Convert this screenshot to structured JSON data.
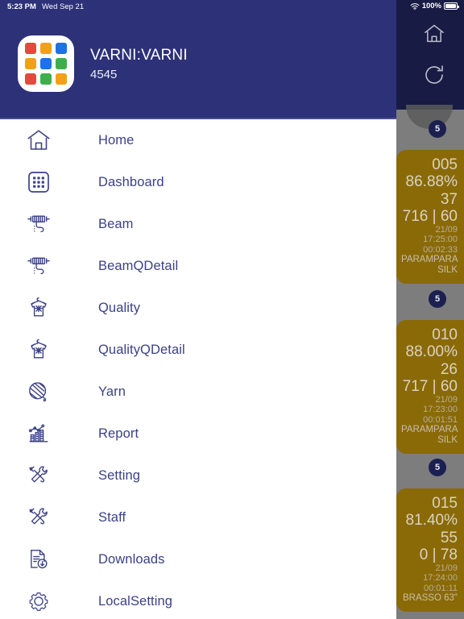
{
  "status_bar": {
    "time": "5:23 PM",
    "date": "Wed Sep 21",
    "battery_percent": "100%",
    "wifi_icon": "wifi-icon",
    "battery_icon": "battery-full-icon"
  },
  "drawer": {
    "brand": {
      "title": "VARNI:VARNI",
      "subtitle": "4545",
      "logo_icon": "app-grid-logo",
      "logo_colors": [
        "#e34a3c",
        "#f2a117",
        "#1a73e8",
        "#f2a117",
        "#1a73e8",
        "#3eae4b",
        "#e34a3c",
        "#3eae4b",
        "#f2a117"
      ]
    },
    "items": [
      {
        "label": "Home",
        "icon": "home-icon"
      },
      {
        "label": "Dashboard",
        "icon": "dashboard-grid-icon"
      },
      {
        "label": "Beam",
        "icon": "beam-roller-icon"
      },
      {
        "label": "BeamQDetail",
        "icon": "beam-roller-icon"
      },
      {
        "label": "Quality",
        "icon": "tshirt-hanger-icon"
      },
      {
        "label": "QualityQDetail",
        "icon": "tshirt-hanger-icon"
      },
      {
        "label": "Yarn",
        "icon": "yarn-ball-icon"
      },
      {
        "label": "Report",
        "icon": "bar-chart-icon"
      },
      {
        "label": "Setting",
        "icon": "tools-cross-icon"
      },
      {
        "label": "Staff",
        "icon": "tools-cross-icon"
      },
      {
        "label": "Downloads",
        "icon": "document-download-icon"
      },
      {
        "label": "LocalSetting",
        "icon": "gear-icon"
      }
    ]
  },
  "background_app": {
    "toolbar": {
      "home_icon": "home-icon",
      "refresh_icon": "refresh-icon"
    },
    "machine_cards": [
      {
        "badge": "5",
        "machine_no": "005",
        "efficiency": "86.88%",
        "pick": "37",
        "counts": "716 | 60",
        "timestamp": "21/09 17:25:00",
        "duration": "00:02:33",
        "quality_name": "PARAMPARA SILK",
        "card_color": "#8a6a07"
      },
      {
        "badge": "5",
        "machine_no": "010",
        "efficiency": "88.00%",
        "pick": "26",
        "counts": "717 | 60",
        "timestamp": "21/09 17:23:00",
        "duration": "00:01:51",
        "quality_name": "PARAMPARA SILK",
        "card_color": "#8a6a07"
      },
      {
        "badge": "5",
        "machine_no": "015",
        "efficiency": "81.40%",
        "pick": "55",
        "counts": "0 | 78",
        "timestamp": "21/09 17:24:00",
        "duration": "00:01:11",
        "quality_name": "BRASSO 63\"",
        "card_color": "#8a6a07"
      }
    ]
  },
  "theme": {
    "drawer_header_bg": "#2c3178",
    "toolbar_bg": "#181b43",
    "accent": "#3b4186",
    "card_amber": "#8a6a07",
    "backdrop_gray": "#7d7d7d"
  }
}
